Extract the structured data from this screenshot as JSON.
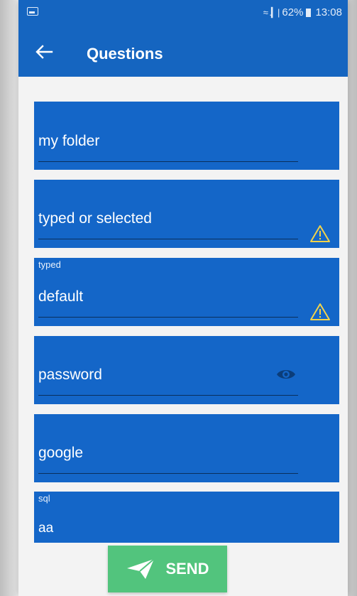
{
  "status_bar": {
    "battery_percent": "62%",
    "time": "13:08",
    "signal_text": "≈ .▎|"
  },
  "toolbar": {
    "back_icon": "arrow-left",
    "title": "Questions"
  },
  "fields": [
    {
      "label": "",
      "value": "my folder",
      "icon": ""
    },
    {
      "label": "",
      "value": "typed or selected",
      "icon": "warning-triangle"
    },
    {
      "label": "typed",
      "value": "default",
      "icon": "warning-triangle"
    },
    {
      "label": "",
      "value": "password",
      "icon": "eye"
    },
    {
      "label": "",
      "value": "google",
      "icon": ""
    },
    {
      "label": "sql",
      "value": "aa",
      "icon": ""
    }
  ],
  "send_button": {
    "label": "SEND",
    "icon": "paper-plane"
  },
  "colors": {
    "primary": "#1565c0",
    "field_bg": "#1466c8",
    "send_bg": "#52c47d",
    "warning": "#f2d34a"
  }
}
